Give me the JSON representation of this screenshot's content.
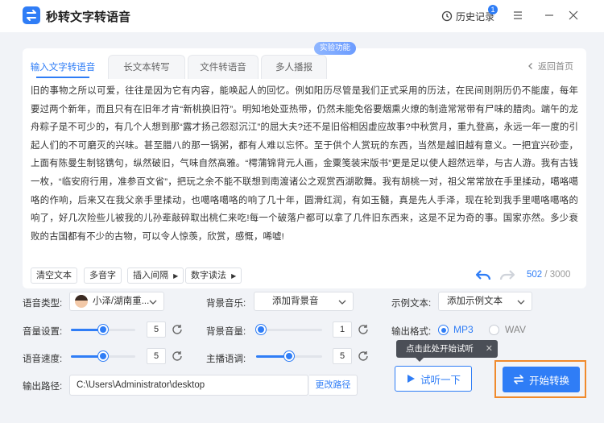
{
  "app": {
    "title": "秒转文字转语音",
    "history_label": "历史记录",
    "history_badge": "1"
  },
  "tabs": [
    {
      "label": "输入文字转语音",
      "active": true
    },
    {
      "label": "长文本转写"
    },
    {
      "label": "文件转语音"
    },
    {
      "label": "多人播报"
    }
  ],
  "beta_tag": "实验功能",
  "back_home": "返回首页",
  "text_content": "旧的事物之所以可爱，往往是因为它有内容，能唤起人的回忆。例如阳历尽管是我们正式采用的历法，在民间则阴历仍不能废，每年要过两个新年，而且只有在旧年才肯“新桃换旧符”。明知地处亚热带，仍然未能免俗要烟熏火燎的制造常常带有尸味的腊肉。端午的龙舟粽子是不可少的，有几个人想到那“露才扬己怨怼沉江”的屈大夫?还不是旧俗相因虚应故事?中秋赏月，重九登高，永远一年一度的引起人们的不可磨灭的兴味。甚至腊八的那一锅粥，都有人难以忘怀。至于供个人赏玩的东西，当然是越旧越有意义。一把宜兴砂壶，上面有陈曼生制铭镌句，纵然破旧，气味自然高雅。“樗蒲锦背元人画，金粟笺装宋版书”更是足以使人超然远举，与古人游。我有古钱一枚，“临安府行用，准参百文省”，把玩之余不能不联想到南渡诸公之观赏西湖歌舞。我有胡桃一对，祖父常常放在手里揉动，噶咯噶咯的作响，后来又在我父亲手里揉动，也噶咯噶咯的响了几十年，圆滑红润，有如玉髓，真是先人手泽，现在轮到我手里噶咯噶咯的响了，好几次险些儿被我的儿孙辈敲碎取出桃仁来吃!每一个破落户都可以拿了几件旧东西来，这是不足为奇的事。国家亦然。多少衰败的古国都有不少的古物，可以令人惊羡，欣赏，感慨，唏嘘!",
  "toolbar": {
    "clear": "清空文本",
    "polyphone": "多音字",
    "insert_pause": "插入间隔",
    "number_reading": "数字读法"
  },
  "counter": {
    "current": "502",
    "max": "/ 3000"
  },
  "settings": {
    "voice_type_label": "语音类型:",
    "voice_type_value": "小泽/湖南重...",
    "bg_music_label": "背景音乐:",
    "bg_music_value": "添加背景音",
    "sample_text_label": "示例文本:",
    "sample_text_value": "添加示例文本",
    "volume_label": "音量设置:",
    "volume_value": "5",
    "volume_level": 0.5,
    "bg_volume_label": "背景音量:",
    "bg_volume_value": "1",
    "bg_volume_level": 0.0,
    "speed_label": "语音速度:",
    "speed_value": "5",
    "speed_level": 0.5,
    "pitch_label": "主播语调:",
    "pitch_value": "5",
    "pitch_level": 0.5,
    "output_format_label": "输出格式:",
    "format_mp3": "MP3",
    "format_wav": "WAV",
    "output_path_label": "输出路径:",
    "output_path_value": "C:\\Users\\Administrator\\desktop",
    "change_path": "更改路径"
  },
  "tooltip": {
    "text": "点击此处开始试听",
    "close": "✕"
  },
  "actions": {
    "listen": "试听一下",
    "convert": "开始转换"
  },
  "colors": {
    "accent": "#2f7df6",
    "highlight": "#f08a2c"
  }
}
